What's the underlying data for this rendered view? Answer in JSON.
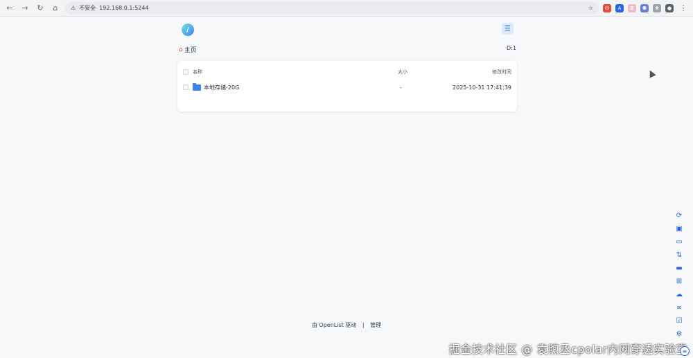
{
  "browser": {
    "security_label": "不安全",
    "url": "192.168.0.1:5244"
  },
  "breadcrumb": {
    "home_label": "主页"
  },
  "disk_label": "D:1",
  "table": {
    "headers": {
      "name": "名称",
      "size": "大小",
      "modified": "修改时间"
    },
    "rows": [
      {
        "name": "本地存储-20G",
        "size": "-",
        "modified": "2025-10-31 17:41:39"
      }
    ]
  },
  "footer": {
    "prefix": "由",
    "brand": "OpenList",
    "suffix": "驱动",
    "separator": "|",
    "manage": "管理"
  },
  "watermark": "掘金技术社区 @ 袁煦丞cpolar内网穿透实验室",
  "colors": {
    "accent": "#2563eb",
    "folder": "#3b82f6",
    "background": "#f7f8fa"
  }
}
